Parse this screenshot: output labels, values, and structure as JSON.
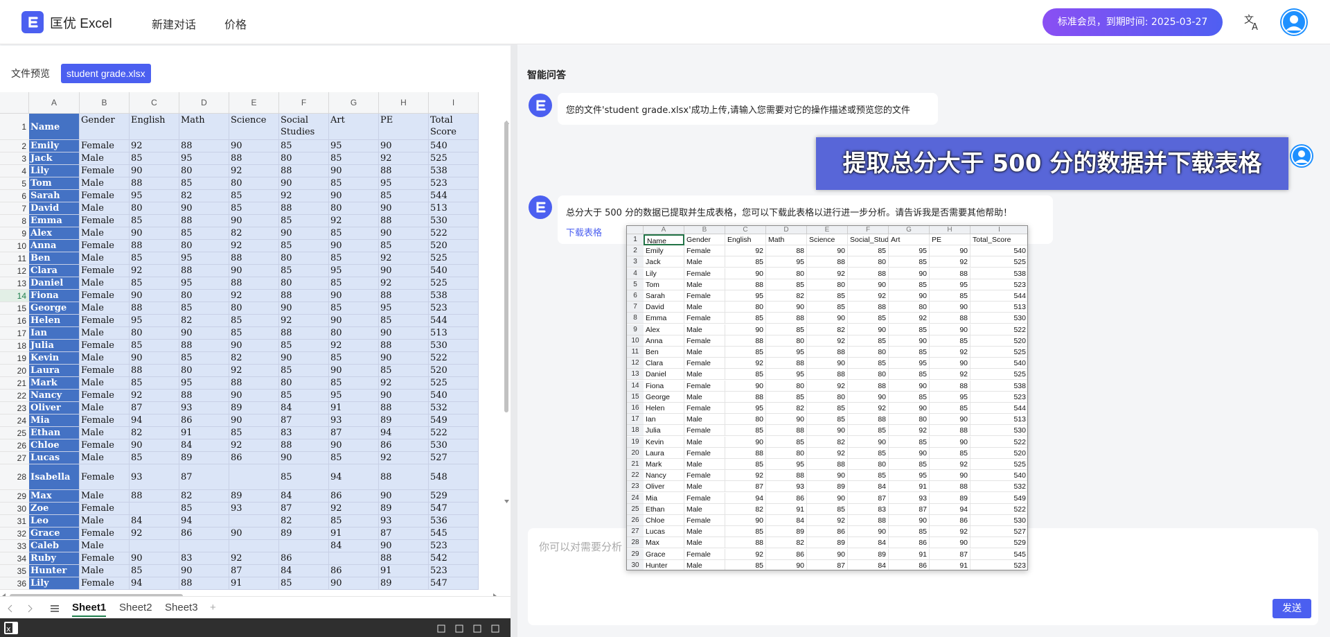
{
  "app": {
    "title": "匡优 Excel",
    "nav": [
      "新建对话",
      "价格"
    ],
    "membership": "标准会员，到期时间: 2025-03-27"
  },
  "colors": {
    "accent": "#4b5ff0",
    "name_column": "#4472c4",
    "cell_fill": "#dbe5f7"
  },
  "left": {
    "preview_label": "文件预览",
    "file_name": "student grade.xlsx"
  },
  "sheet": {
    "columns": [
      "A",
      "B",
      "C",
      "D",
      "E",
      "F",
      "G",
      "H",
      "I"
    ],
    "headers": [
      "Name",
      "Gender",
      "English",
      "Math",
      "Science",
      "Social Studies",
      "Art",
      "PE",
      "Total Score"
    ],
    "row_numbers": [
      "1",
      "2",
      "3",
      "4",
      "5",
      "6",
      "7",
      "8",
      "9",
      "10",
      "11",
      "12",
      "13",
      "14",
      "15",
      "16",
      "17",
      "18",
      "19",
      "20",
      "21",
      "22",
      "23",
      "24",
      "25",
      "26",
      "27",
      "28",
      "29",
      "30",
      "31",
      "32",
      "33",
      "34",
      "35",
      "36"
    ],
    "rows": [
      [
        "Emily",
        "Female",
        "92",
        "88",
        "90",
        "85",
        "95",
        "90",
        "540"
      ],
      [
        "Jack",
        "Male",
        "85",
        "95",
        "88",
        "80",
        "85",
        "92",
        "525"
      ],
      [
        "Lily",
        "Female",
        "90",
        "80",
        "92",
        "88",
        "90",
        "88",
        "538"
      ],
      [
        "Tom",
        "Male",
        "88",
        "85",
        "80",
        "90",
        "85",
        "95",
        "523"
      ],
      [
        "Sarah",
        "Female",
        "95",
        "82",
        "85",
        "92",
        "90",
        "85",
        "544"
      ],
      [
        "David",
        "Male",
        "80",
        "90",
        "85",
        "88",
        "80",
        "90",
        "513"
      ],
      [
        "Emma",
        "Female",
        "85",
        "88",
        "90",
        "85",
        "92",
        "88",
        "530"
      ],
      [
        "Alex",
        "Male",
        "90",
        "85",
        "82",
        "90",
        "85",
        "90",
        "522"
      ],
      [
        "Anna",
        "Female",
        "88",
        "80",
        "92",
        "85",
        "90",
        "85",
        "520"
      ],
      [
        "Ben",
        "Male",
        "85",
        "95",
        "88",
        "80",
        "85",
        "92",
        "525"
      ],
      [
        "Clara",
        "Female",
        "92",
        "88",
        "90",
        "85",
        "95",
        "90",
        "540"
      ],
      [
        "Daniel",
        "Male",
        "85",
        "95",
        "88",
        "80",
        "85",
        "92",
        "525"
      ],
      [
        "Fiona",
        "Female",
        "90",
        "80",
        "92",
        "88",
        "90",
        "88",
        "538"
      ],
      [
        "George",
        "Male",
        "88",
        "85",
        "80",
        "90",
        "85",
        "95",
        "523"
      ],
      [
        "Helen",
        "Female",
        "95",
        "82",
        "85",
        "92",
        "90",
        "85",
        "544"
      ],
      [
        "Ian",
        "Male",
        "80",
        "90",
        "85",
        "88",
        "80",
        "90",
        "513"
      ],
      [
        "Julia",
        "Female",
        "85",
        "88",
        "90",
        "85",
        "92",
        "88",
        "530"
      ],
      [
        "Kevin",
        "Male",
        "90",
        "85",
        "82",
        "90",
        "85",
        "90",
        "522"
      ],
      [
        "Laura",
        "Female",
        "88",
        "80",
        "92",
        "85",
        "90",
        "85",
        "520"
      ],
      [
        "Mark",
        "Male",
        "85",
        "95",
        "88",
        "80",
        "85",
        "92",
        "525"
      ],
      [
        "Nancy",
        "Female",
        "92",
        "88",
        "90",
        "85",
        "95",
        "90",
        "540"
      ],
      [
        "Oliver",
        "Male",
        "87",
        "93",
        "89",
        "84",
        "91",
        "88",
        "532"
      ],
      [
        "Mia",
        "Female",
        "94",
        "86",
        "90",
        "87",
        "93",
        "89",
        "549"
      ],
      [
        "Ethan",
        "Male",
        "82",
        "91",
        "85",
        "83",
        "87",
        "94",
        "522"
      ],
      [
        "Chloe",
        "Female",
        "90",
        "84",
        "92",
        "88",
        "90",
        "86",
        "530"
      ],
      [
        "Lucas",
        "Male",
        "85",
        "89",
        "86",
        "90",
        "85",
        "92",
        "527"
      ],
      [
        "Isabella",
        "Female",
        "93",
        "87",
        "",
        "85",
        "94",
        "88",
        "548"
      ],
      [
        "Max",
        "Male",
        "88",
        "82",
        "89",
        "84",
        "86",
        "90",
        "529"
      ],
      [
        "Zoe",
        "Female",
        "",
        "85",
        "93",
        "87",
        "92",
        "89",
        "547"
      ],
      [
        "Leo",
        "Male",
        "84",
        "94",
        "",
        "82",
        "85",
        "93",
        "536"
      ],
      [
        "Grace",
        "Female",
        "92",
        "86",
        "90",
        "89",
        "91",
        "87",
        "545"
      ],
      [
        "Caleb",
        "Male",
        "",
        "",
        "",
        "",
        "84",
        "90",
        "523"
      ],
      [
        "Ruby",
        "Female",
        "90",
        "83",
        "92",
        "86",
        "",
        "88",
        "542"
      ],
      [
        "Hunter",
        "Male",
        "85",
        "90",
        "87",
        "84",
        "86",
        "91",
        "523"
      ],
      [
        "Lily",
        "Female",
        "94",
        "88",
        "91",
        "85",
        "90",
        "89",
        "547"
      ]
    ],
    "tabs": [
      "Sheet1",
      "Sheet2",
      "Sheet3"
    ],
    "active_tab": "Sheet1",
    "selected_row": "14"
  },
  "chat": {
    "title": "智能问答",
    "bot_msg1": "您的文件'student grade.xlsx'成功上传,请输入您需要对它的操作描述或预览您的文件",
    "user_msg": "提取总分大于 500 分的数据并下载表格",
    "bot_msg2": "总分大于 500 分的数据已提取并生成表格，您可以下载此表格以进行进一步分析。请告诉我是否需要其他帮助！",
    "download_link": "下载表格",
    "input_placeholder": "你可以对需要分析",
    "send": "发送"
  },
  "inset": {
    "columns": [
      "A",
      "B",
      "C",
      "D",
      "E",
      "F",
      "G",
      "H",
      "I"
    ],
    "headers": [
      "Name",
      "Gender",
      "English",
      "Math",
      "Science",
      "Social_Stud",
      "Art",
      "PE",
      "Total_Score"
    ],
    "row_numbers": [
      "1",
      "2",
      "3",
      "4",
      "5",
      "6",
      "7",
      "8",
      "9",
      "10",
      "11",
      "12",
      "13",
      "14",
      "15",
      "16",
      "17",
      "18",
      "19",
      "20",
      "21",
      "22",
      "23",
      "24",
      "25",
      "26",
      "27",
      "28",
      "29",
      "30"
    ],
    "rows": [
      [
        "Emily",
        "Female",
        "92",
        "88",
        "90",
        "85",
        "95",
        "90",
        "540"
      ],
      [
        "Jack",
        "Male",
        "85",
        "95",
        "88",
        "80",
        "85",
        "92",
        "525"
      ],
      [
        "Lily",
        "Female",
        "90",
        "80",
        "92",
        "88",
        "90",
        "88",
        "538"
      ],
      [
        "Tom",
        "Male",
        "88",
        "85",
        "80",
        "90",
        "85",
        "95",
        "523"
      ],
      [
        "Sarah",
        "Female",
        "95",
        "82",
        "85",
        "92",
        "90",
        "85",
        "544"
      ],
      [
        "David",
        "Male",
        "80",
        "90",
        "85",
        "88",
        "80",
        "90",
        "513"
      ],
      [
        "Emma",
        "Female",
        "85",
        "88",
        "90",
        "85",
        "92",
        "88",
        "530"
      ],
      [
        "Alex",
        "Male",
        "90",
        "85",
        "82",
        "90",
        "85",
        "90",
        "522"
      ],
      [
        "Anna",
        "Female",
        "88",
        "80",
        "92",
        "85",
        "90",
        "85",
        "520"
      ],
      [
        "Ben",
        "Male",
        "85",
        "95",
        "88",
        "80",
        "85",
        "92",
        "525"
      ],
      [
        "Clara",
        "Female",
        "92",
        "88",
        "90",
        "85",
        "95",
        "90",
        "540"
      ],
      [
        "Daniel",
        "Male",
        "85",
        "95",
        "88",
        "80",
        "85",
        "92",
        "525"
      ],
      [
        "Fiona",
        "Female",
        "90",
        "80",
        "92",
        "88",
        "90",
        "88",
        "538"
      ],
      [
        "George",
        "Male",
        "88",
        "85",
        "80",
        "90",
        "85",
        "95",
        "523"
      ],
      [
        "Helen",
        "Female",
        "95",
        "82",
        "85",
        "92",
        "90",
        "85",
        "544"
      ],
      [
        "Ian",
        "Male",
        "80",
        "90",
        "85",
        "88",
        "80",
        "90",
        "513"
      ],
      [
        "Julia",
        "Female",
        "85",
        "88",
        "90",
        "85",
        "92",
        "88",
        "530"
      ],
      [
        "Kevin",
        "Male",
        "90",
        "85",
        "82",
        "90",
        "85",
        "90",
        "522"
      ],
      [
        "Laura",
        "Female",
        "88",
        "80",
        "92",
        "85",
        "90",
        "85",
        "520"
      ],
      [
        "Mark",
        "Male",
        "85",
        "95",
        "88",
        "80",
        "85",
        "92",
        "525"
      ],
      [
        "Nancy",
        "Female",
        "92",
        "88",
        "90",
        "85",
        "95",
        "90",
        "540"
      ],
      [
        "Oliver",
        "Male",
        "87",
        "93",
        "89",
        "84",
        "91",
        "88",
        "532"
      ],
      [
        "Mia",
        "Female",
        "94",
        "86",
        "90",
        "87",
        "93",
        "89",
        "549"
      ],
      [
        "Ethan",
        "Male",
        "82",
        "91",
        "85",
        "83",
        "87",
        "94",
        "522"
      ],
      [
        "Chloe",
        "Female",
        "90",
        "84",
        "92",
        "88",
        "90",
        "86",
        "530"
      ],
      [
        "Lucas",
        "Male",
        "85",
        "89",
        "86",
        "90",
        "85",
        "92",
        "527"
      ],
      [
        "Max",
        "Male",
        "88",
        "82",
        "89",
        "84",
        "86",
        "90",
        "529"
      ],
      [
        "Grace",
        "Female",
        "92",
        "86",
        "90",
        "89",
        "91",
        "87",
        "545"
      ],
      [
        "Hunter",
        "Male",
        "85",
        "90",
        "87",
        "84",
        "86",
        "91",
        "523"
      ]
    ]
  }
}
